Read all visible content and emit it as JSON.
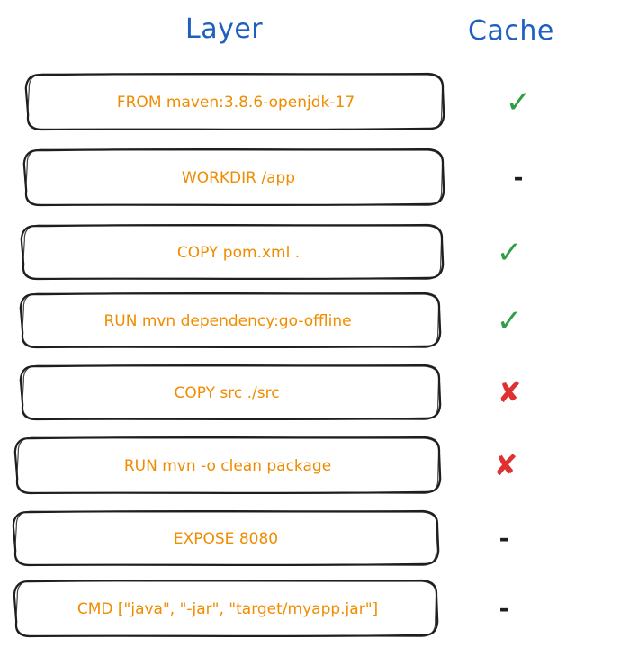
{
  "headers": {
    "layer": "Layer",
    "cache": "Cache"
  },
  "colors": {
    "header": "#1e5fbf",
    "label": "#f08c00",
    "outline": "#1e1e1e",
    "check": "#2f9e44",
    "cross": "#e03131"
  },
  "layers": [
    {
      "label": "FROM maven:3.8.6-openjdk-17",
      "cache": "✓",
      "status": "cached",
      "icon": "check-icon"
    },
    {
      "label": "WORKDIR /app",
      "cache": "-",
      "status": "none",
      "icon": "dash-icon"
    },
    {
      "label": "COPY pom.xml .",
      "cache": "✓",
      "status": "cached",
      "icon": "check-icon"
    },
    {
      "label": "RUN mvn dependency:go-offline",
      "cache": "✓",
      "status": "cached",
      "icon": "check-icon"
    },
    {
      "label": "COPY src ./src",
      "cache": "✘",
      "status": "invalidated",
      "icon": "cross-icon"
    },
    {
      "label": "RUN mvn -o clean package",
      "cache": "✘",
      "status": "invalidated",
      "icon": "cross-icon"
    },
    {
      "label": "EXPOSE 8080",
      "cache": "-",
      "status": "none",
      "icon": "dash-icon"
    },
    {
      "label": "CMD [\"java\", \"-jar\", \"target/myapp.jar\"]",
      "cache": "-",
      "status": "none",
      "icon": "dash-icon"
    }
  ]
}
